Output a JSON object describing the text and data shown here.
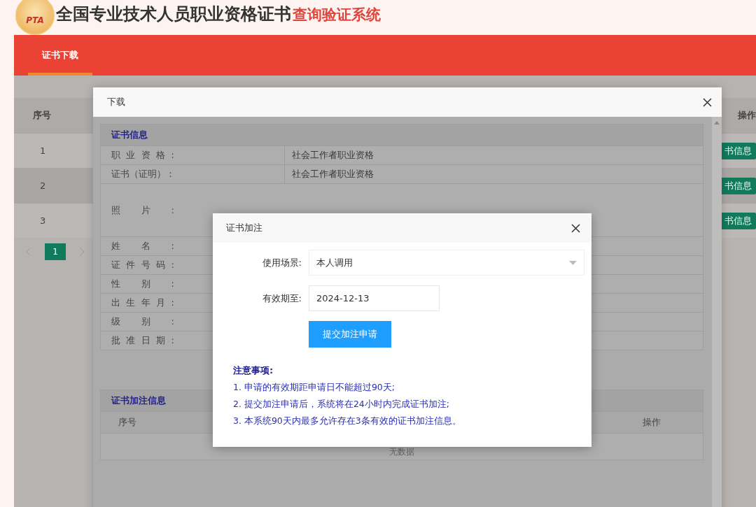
{
  "header": {
    "logo_text": "PTA",
    "title": "全国专业技术人员职业资格证书",
    "subtitle": "查询验证系统"
  },
  "nav": {
    "tabs": [
      {
        "label": "证书下载",
        "selected": true
      }
    ]
  },
  "table": {
    "columns": [
      "序号",
      "操作"
    ],
    "rows": [
      {
        "index": "1",
        "action": "书信息",
        "selected": false
      },
      {
        "index": "2",
        "action": "书信息",
        "selected": true
      },
      {
        "index": "3",
        "action": "书信息",
        "selected": false
      }
    ]
  },
  "pagination": {
    "pages": [
      {
        "label": "1",
        "selected": true
      }
    ]
  },
  "download_dialog": {
    "title": "下载",
    "info_section": {
      "title": "证书信息",
      "fields": [
        {
          "label": "职业资格:",
          "value": "社会工作者职业资格",
          "kind": "text"
        },
        {
          "label": "证书（证明）：",
          "value": "社会工作者职业资格",
          "kind": "text"
        },
        {
          "label": "照片:",
          "kind": "photo"
        },
        {
          "label": "姓名:",
          "kind": "text"
        },
        {
          "label": "证件号码:",
          "kind": "text"
        },
        {
          "label": "性别:",
          "kind": "text"
        },
        {
          "label": "出生年月:",
          "kind": "text"
        },
        {
          "label": "级别:",
          "kind": "text"
        },
        {
          "label": "批准日期:",
          "kind": "text"
        }
      ]
    },
    "annotation_section": {
      "title": "证书加注信息",
      "columns": [
        "序号",
        "操作"
      ],
      "empty_text": "无数据"
    }
  },
  "annotation_dialog": {
    "title": "证书加注",
    "fields": [
      {
        "kind": "select",
        "label": "使用场景:",
        "value": "本人调用"
      },
      {
        "kind": "date",
        "label": "有效期至:",
        "value": "2024-12-13"
      }
    ],
    "submit": "提交加注申请",
    "notes_title": "注意事项:",
    "notes": [
      "1. 申请的有效期距申请日不能超过90天;",
      "2. 提交加注申请后，系统将在24小时内完成证书加注;",
      "3. 本系统90天内最多允许存在3条有效的证书加注信息。"
    ]
  }
}
